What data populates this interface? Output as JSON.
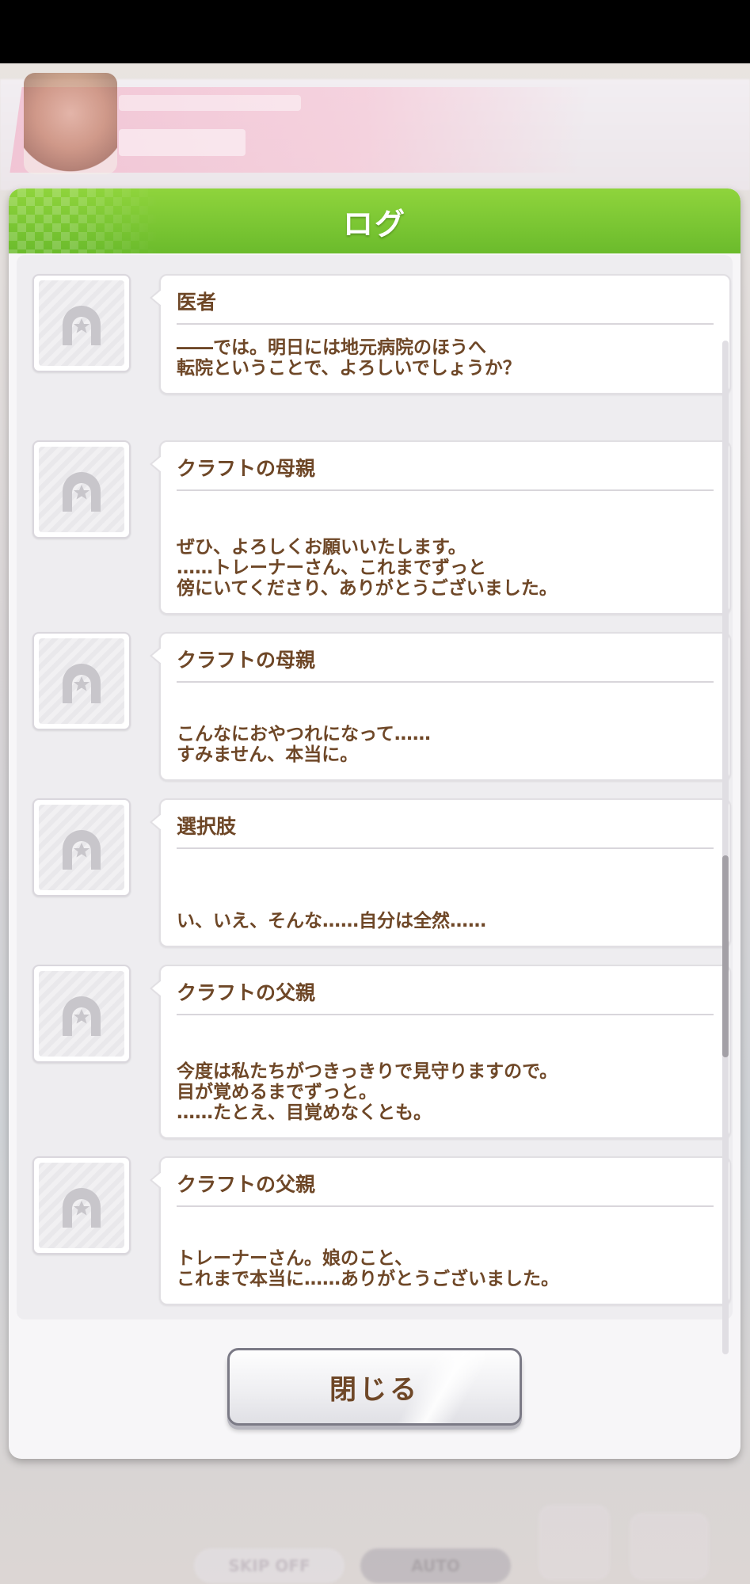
{
  "background": {
    "skip_label": "SKIP OFF",
    "auto_label": "AUTO"
  },
  "dialog": {
    "title": "ログ",
    "close_label": "閉じる"
  },
  "log": [
    {
      "speaker": "医者",
      "lines": [
        "――では。明日には地元病院のほうへ",
        "転院ということで、よろしいでしょうか？"
      ]
    },
    {
      "speaker": "クラフトの母親",
      "lines": [
        "ぜひ、よろしくお願いいたします。",
        "……トレーナーさん、これまでずっと",
        "傍にいてくださり、ありがとうございました。"
      ]
    },
    {
      "speaker": "クラフトの母親",
      "lines": [
        "こんなにおやつれになって……",
        "すみません、本当に。"
      ]
    },
    {
      "speaker": "選択肢",
      "lines": [
        "い、いえ、そんな……自分は全然……"
      ]
    },
    {
      "speaker": "クラフトの父親",
      "lines": [
        "今度は私たちがつきっきりで見守りますので。",
        "目が覚めるまでずっと。",
        "……たとえ、目覚めなくとも。"
      ]
    },
    {
      "speaker": "クラフトの父親",
      "lines": [
        "トレーナーさん。娘のこと、",
        "これまで本当に……ありがとうございました。"
      ]
    }
  ],
  "icons": {
    "avatar_placeholder": "horseshoe-star-icon",
    "menu": "hamburger-menu-icon",
    "log": "log-icon"
  },
  "colors": {
    "header_green": "#7cc734",
    "text_brown": "#6e4727",
    "dialog_bg": "#f7f6f8"
  }
}
